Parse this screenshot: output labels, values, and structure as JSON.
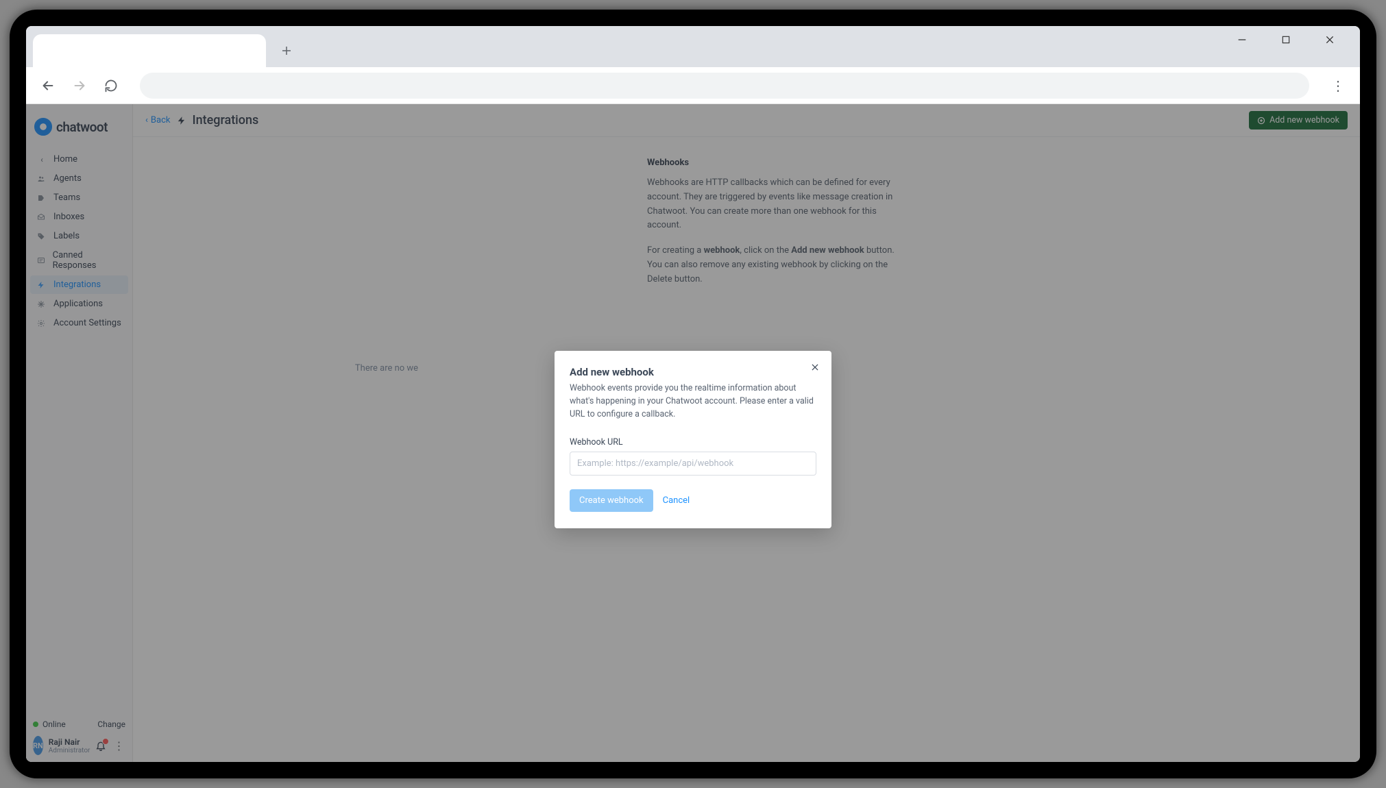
{
  "brand": "chatwoot",
  "sidebar": {
    "items": [
      {
        "label": "Home",
        "icon": "‹"
      },
      {
        "label": "Agents",
        "icon": "👥"
      },
      {
        "label": "Teams",
        "icon": "⚑"
      },
      {
        "label": "Inboxes",
        "icon": "✉"
      },
      {
        "label": "Labels",
        "icon": "🏷"
      },
      {
        "label": "Canned Responses",
        "icon": "≡"
      },
      {
        "label": "Integrations",
        "icon": "⚡"
      },
      {
        "label": "Applications",
        "icon": "✳"
      },
      {
        "label": "Account Settings",
        "icon": "⚙"
      }
    ],
    "status": {
      "label": "Online",
      "change": "Change"
    },
    "user": {
      "initials": "RN",
      "name": "Raji Nair",
      "role": "Administrator"
    }
  },
  "header": {
    "back": "Back",
    "title": "Integrations",
    "add_button": "Add new webhook"
  },
  "content": {
    "empty": "There are no we",
    "info_title": "Webhooks",
    "info_p1": "Webhooks are HTTP callbacks which can be defined for every account. They are triggered by events like message creation in Chatwoot. You can create more than one webhook for this account.",
    "info_p2_pre": "For creating a ",
    "info_p2_b1": "webhook",
    "info_p2_mid": ", click on the ",
    "info_p2_b2": "Add new webhook",
    "info_p2_post": " button. You can also remove any existing webhook by clicking on the Delete button."
  },
  "modal": {
    "title": "Add new webhook",
    "desc": "Webhook events provide you the realtime information about what's happening in your Chatwoot account. Please enter a valid URL to configure a callback.",
    "label": "Webhook URL",
    "placeholder": "Example: https://example/api/webhook",
    "create": "Create webhook",
    "cancel": "Cancel"
  }
}
